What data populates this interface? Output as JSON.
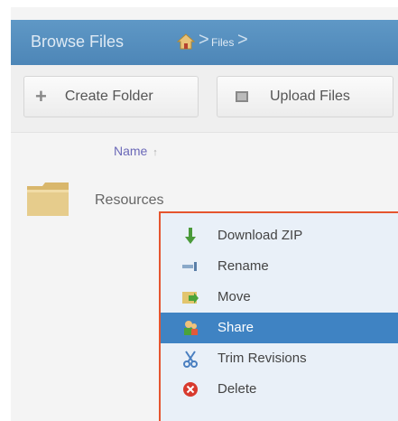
{
  "header": {
    "title": "Browse Files",
    "breadcrumb": [
      {
        "icon": "home-icon"
      },
      {
        "label": "Files"
      }
    ],
    "separator": ">"
  },
  "toolbar": {
    "create_folder_label": "Create Folder",
    "upload_files_label": "Upload Files"
  },
  "table": {
    "column_name": "Name",
    "sort_indicator": "↑",
    "rows": [
      {
        "icon": "folder-icon",
        "name": "Resources"
      }
    ]
  },
  "context_menu": {
    "items": [
      {
        "icon": "download-arrow-icon",
        "label": "Download ZIP",
        "selected": false
      },
      {
        "icon": "rename-icon",
        "label": "Rename",
        "selected": false
      },
      {
        "icon": "move-folder-icon",
        "label": "Move",
        "selected": false
      },
      {
        "icon": "share-users-icon",
        "label": "Share",
        "selected": true
      },
      {
        "icon": "scissors-icon",
        "label": "Trim Revisions",
        "selected": false
      },
      {
        "icon": "delete-x-icon",
        "label": "Delete",
        "selected": false
      }
    ],
    "selected_color": "#3f83c3",
    "border_color": "#e5552f"
  },
  "colors": {
    "header_bg": "#5a92c2",
    "column_header_text": "#6b69b8"
  }
}
